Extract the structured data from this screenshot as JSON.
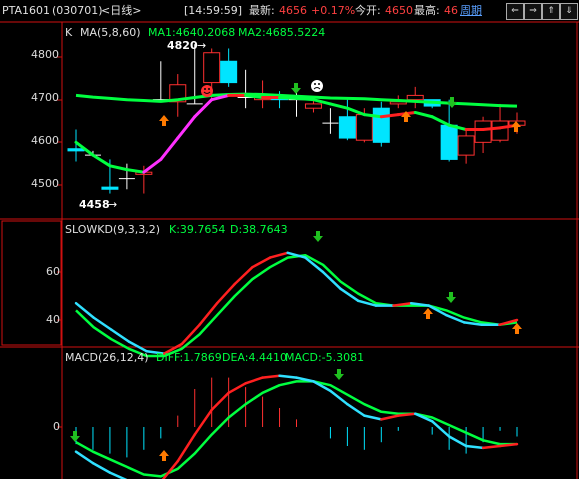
{
  "header": {
    "symbol": "PTA1601",
    "code": "(030701)",
    "period": "<日线>",
    "time": "[14:59:59]",
    "latest_label": "最新:",
    "latest": "4656",
    "change": "+0.17%",
    "open_label": "今开:",
    "open": "4650",
    "high_label": "最高:",
    "high": "46",
    "cycle_label": "周期",
    "buttons": [
      "⇐",
      "⇒",
      "⇑",
      "⇓"
    ]
  },
  "main": {
    "k_label": "K",
    "ma_label": "MA(5,8,60)",
    "ma1_label": "MA1:4640.2068",
    "ma2_label": "MA2:4685.5224",
    "y_ticks": [
      "4800",
      "4700",
      "4600",
      "4500"
    ],
    "max_label": "4820",
    "min_label": "4458",
    "colors": {
      "up": "#ff3030",
      "down": "#00e5ff",
      "ma1_up": "#ff2020",
      "ma1_down": "#ff30ff",
      "ma2": "#00ff40"
    }
  },
  "kd": {
    "label": "SLOWKD(9,3,3,2)",
    "k_label": "K:39.7654",
    "d_label": "D:38.7643",
    "y_ticks": [
      "60",
      "40"
    ]
  },
  "macd": {
    "label": "MACD(26,12,4)",
    "diff_label": "DIFF:1.7869",
    "dea_label": "DEA:4.4410",
    "macd_label": "MACD:-5.3081",
    "y_ticks": [
      "0"
    ]
  },
  "chart_data": [
    {
      "type": "candlestick",
      "title": "PTA1601 <日线>",
      "ylim": [
        4420,
        4860
      ],
      "x": [
        1,
        2,
        3,
        4,
        5,
        6,
        7,
        8,
        9,
        10,
        11,
        12,
        13,
        14,
        15,
        16,
        17,
        18,
        19,
        20,
        21,
        22,
        23,
        24,
        25,
        26,
        27
      ],
      "open": [
        4585,
        4570,
        4495,
        4515,
        4525,
        4700,
        4695,
        4690,
        4740,
        4790,
        4705,
        4700,
        4705,
        4700,
        4680,
        4645,
        4660,
        4605,
        4680,
        4690,
        4700,
        4700,
        4640,
        4570,
        4600,
        4605,
        4640
      ],
      "close": [
        4580,
        4570,
        4490,
        4515,
        4530,
        4700,
        4735,
        4690,
        4810,
        4740,
        4705,
        4705,
        4700,
        4700,
        4690,
        4645,
        4610,
        4665,
        4600,
        4695,
        4710,
        4685,
        4560,
        4615,
        4650,
        4650,
        4650
      ],
      "high": [
        4630,
        4580,
        4560,
        4550,
        4545,
        4790,
        4760,
        4830,
        4820,
        4820,
        4770,
        4745,
        4720,
        4730,
        4705,
        4680,
        4700,
        4680,
        4695,
        4710,
        4730,
        4700,
        4700,
        4630,
        4660,
        4690,
        4670
      ],
      "low": [
        4555,
        4570,
        4480,
        4490,
        4480,
        4700,
        4660,
        4690,
        4700,
        4730,
        4680,
        4680,
        4680,
        4660,
        4670,
        4620,
        4605,
        4600,
        4590,
        4680,
        4680,
        4680,
        4555,
        4550,
        4575,
        4600,
        4620
      ],
      "series": [
        {
          "name": "MA1",
          "values": [
            4600,
            4570,
            4545,
            4536,
            4530,
            4560,
            4610,
            4660,
            4700,
            4710,
            4710,
            4705,
            4705,
            4703,
            4700,
            4690,
            4680,
            4665,
            4660,
            4665,
            4670,
            4660,
            4640,
            4630,
            4630,
            4634,
            4640
          ]
        },
        {
          "name": "MA2",
          "values": [
            4710,
            4706,
            4703,
            4700,
            4698,
            4696,
            4700,
            4705,
            4710,
            4712,
            4713,
            4712,
            4710,
            4708,
            4706,
            4704,
            4703,
            4702,
            4700,
            4698,
            4696,
            4694,
            4692,
            4690,
            4688,
            4686,
            4685
          ]
        }
      ],
      "annotations": [
        "4820",
        "4458"
      ]
    },
    {
      "type": "line",
      "title": "SLOWKD(9,3,3,2)",
      "ylim": [
        24,
        87
      ],
      "series": [
        {
          "name": "K",
          "values": [
            47,
            41,
            36,
            31,
            27,
            26,
            30,
            38,
            47,
            55,
            62,
            66,
            68,
            66,
            60,
            53,
            48,
            46,
            46,
            47,
            46,
            42,
            39,
            38,
            38,
            40
          ]
        },
        {
          "name": "D",
          "values": [
            44,
            37,
            32,
            28,
            25,
            25,
            28,
            34,
            42,
            50,
            57,
            62,
            66,
            67,
            63,
            56,
            51,
            47,
            46,
            46,
            46,
            44,
            41,
            39,
            38,
            39
          ]
        }
      ],
      "y_ticks": [
        60,
        40
      ]
    },
    {
      "type": "line",
      "title": "MACD(26,12,4)",
      "ylim": [
        -38,
        53
      ],
      "series": [
        {
          "name": "DIFF",
          "values": [
            -13,
            -19,
            -24,
            -28,
            -31,
            -29,
            -18,
            -4,
            9,
            18,
            23,
            26,
            27,
            26,
            24,
            19,
            12,
            6,
            4,
            6,
            7,
            3,
            -5,
            -10,
            -11,
            -10,
            -9
          ]
        },
        {
          "name": "DEA",
          "values": [
            -8,
            -13,
            -17,
            -21,
            -25,
            -26,
            -22,
            -14,
            -4,
            5,
            12,
            18,
            22,
            24,
            24,
            22,
            17,
            12,
            8,
            7,
            7,
            5,
            1,
            -3,
            -7,
            -9,
            -9
          ]
        },
        {
          "name": "MACD",
          "values": [
            -9,
            -12,
            -14,
            -16,
            -12,
            -6,
            6,
            20,
            26,
            26,
            21,
            16,
            10,
            4,
            0,
            -6,
            -10,
            -12,
            -8,
            -2,
            0,
            -4,
            -12,
            -14,
            -8,
            -2,
            -5
          ]
        }
      ],
      "y_ticks": [
        0
      ]
    }
  ]
}
